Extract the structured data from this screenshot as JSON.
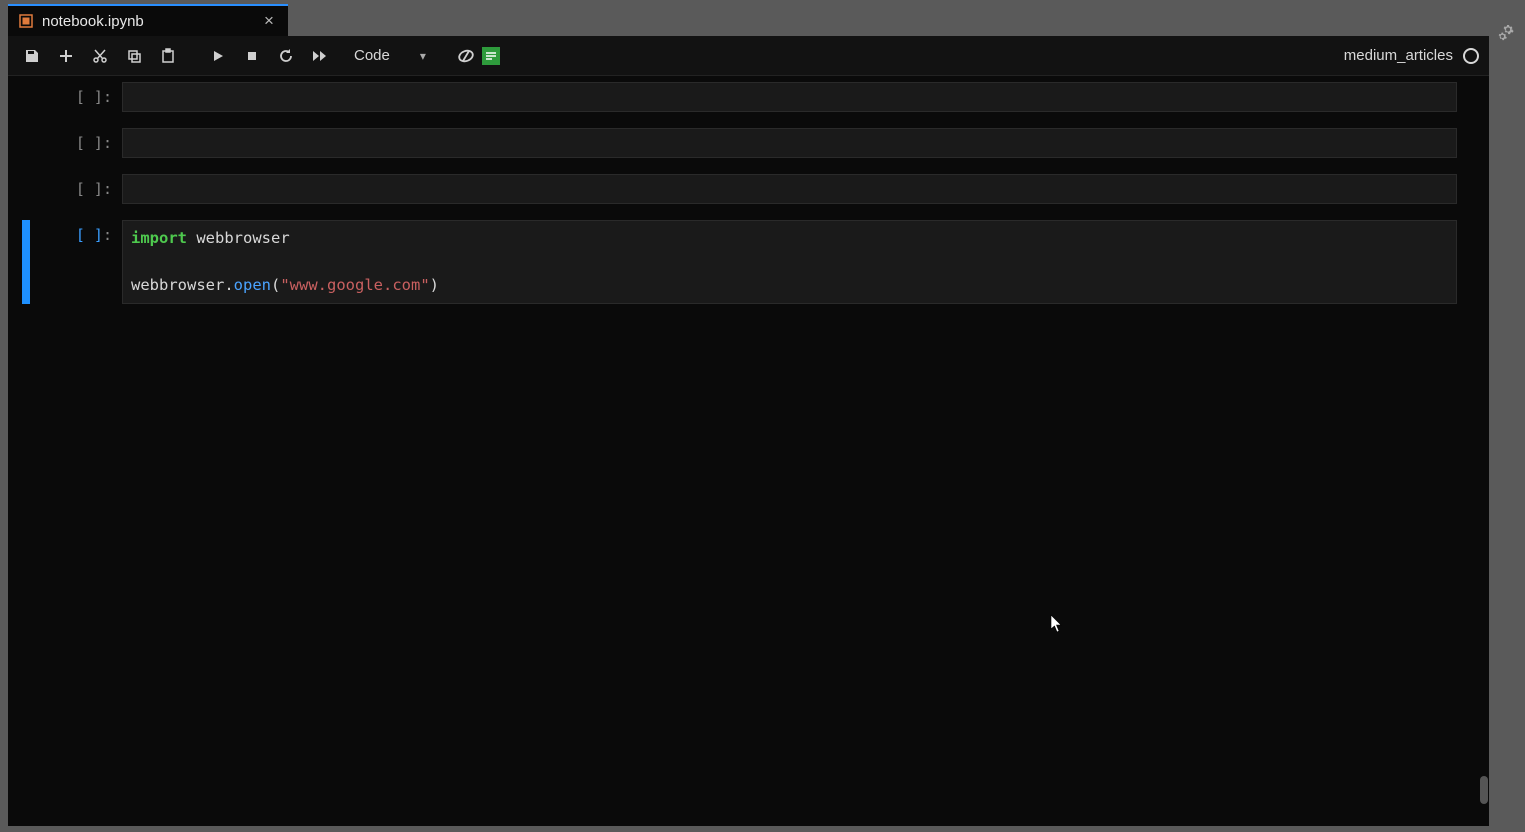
{
  "tab": {
    "title": "notebook.ipynb"
  },
  "toolbar": {
    "cell_type": "Code",
    "kernel_name": "medium_articles"
  },
  "prompts": {
    "prompt": "[ ]:"
  },
  "cells": [
    {
      "active": false,
      "code_html": ""
    },
    {
      "active": false,
      "code_html": ""
    },
    {
      "active": false,
      "code_html": ""
    },
    {
      "active": true,
      "code_html": "<span class=\"tok-keyword\">import</span> webbrowser\n\nwebbrowser<span class=\"tok-punct\">.</span><span class=\"tok-func\">open</span><span class=\"tok-punct\">(</span><span class=\"tok-string\">\"www.google.com\"</span><span class=\"tok-punct\">)</span>"
    }
  ],
  "code_lines_raw": [
    "import webbrowser",
    "",
    "webbrowser.open(\"www.google.com\")"
  ]
}
